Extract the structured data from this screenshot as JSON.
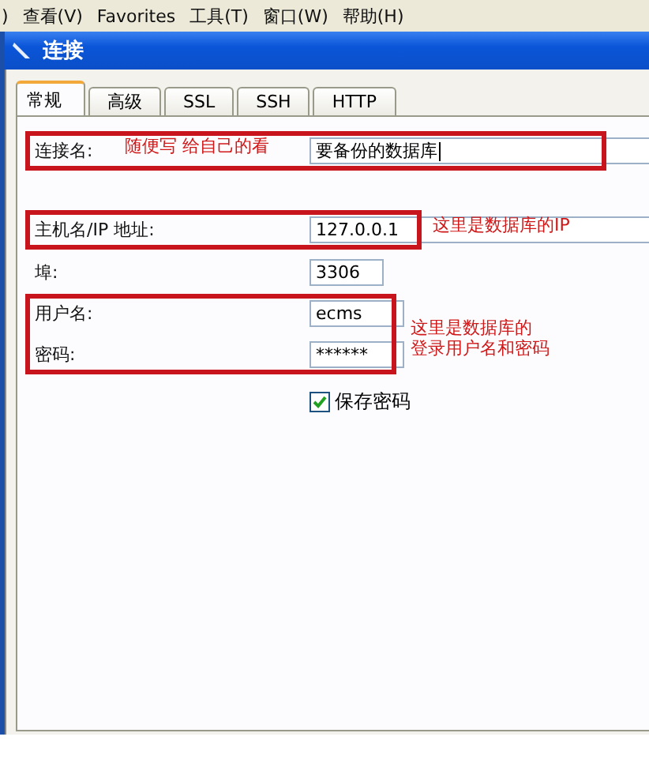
{
  "menu_bar": [
    {
      "label": ")"
    },
    {
      "label": "查看(V)"
    },
    {
      "label": "Favorites"
    },
    {
      "label": "工具(T)"
    },
    {
      "label": "窗口(W)"
    },
    {
      "label": "帮助(H)"
    }
  ],
  "dialog": {
    "title": "连接",
    "tabs": [
      {
        "label": "常规",
        "selected": true
      },
      {
        "label": "高级",
        "selected": false
      },
      {
        "label": "SSL",
        "selected": false
      },
      {
        "label": "SSH",
        "selected": false
      },
      {
        "label": "HTTP",
        "selected": false
      }
    ],
    "fields": [
      {
        "label": "连接名:",
        "value": "要备份的数据库",
        "highlighted": true,
        "note": "随便写 给自己的看"
      },
      {
        "label": "主机名/IP 地址:",
        "value": "127.0.0.1",
        "highlighted": true,
        "note": "这里是数据库的IP"
      },
      {
        "label": "埠:",
        "value": "3306",
        "highlighted": false
      },
      {
        "label": "用户名:",
        "value": "ecms",
        "highlighted": true,
        "note": "这里是数据库的"
      },
      {
        "label": "密码:",
        "value": "******",
        "highlighted": true,
        "note": "登录用户名和密码"
      }
    ],
    "save_password": {
      "label": "保存密码",
      "checked": true
    }
  }
}
